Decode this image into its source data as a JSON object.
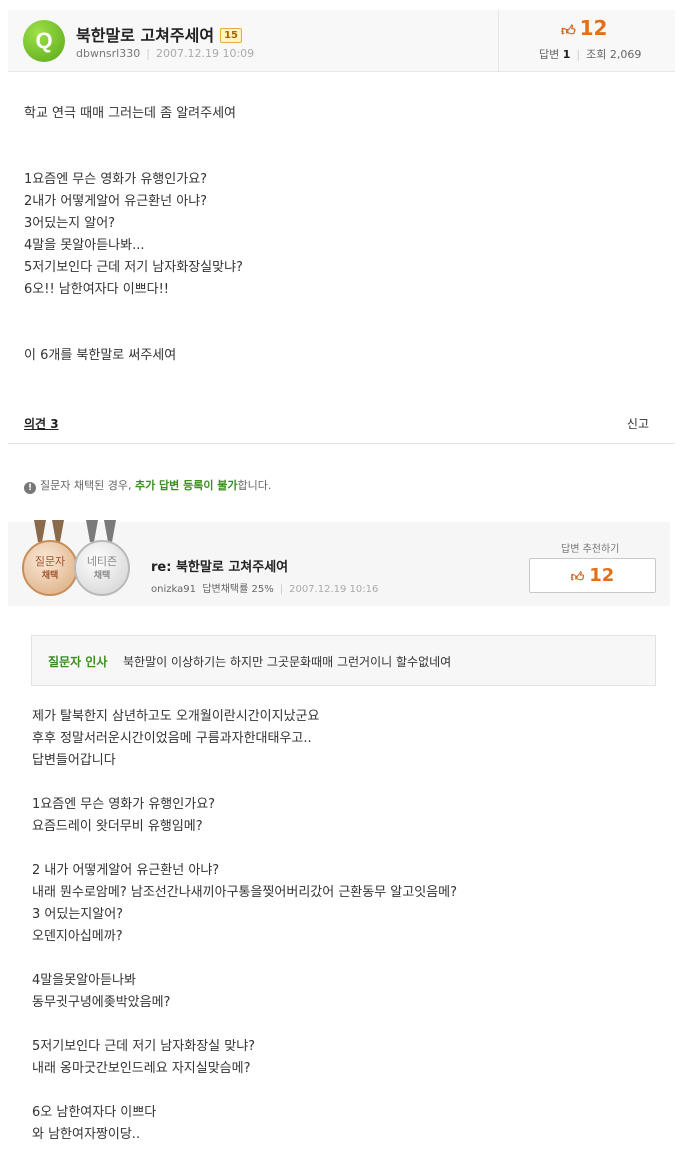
{
  "question": {
    "icon_letter": "Q",
    "title": "북한말로 고쳐주세여",
    "level": "15",
    "author": "dbwnsrl330",
    "date": "2007.12.19 10:09",
    "likes": "12",
    "answers_label": "답변",
    "answers_count": "1",
    "views_label": "조회",
    "views_count": "2,069",
    "intro": "학교 연극 때매 그러는데 좀 알려주세여",
    "lines": [
      "1요즘엔 무슨 영화가 유행인가요?",
      "2내가 어떻게알어 유근환넌 아냐?",
      "3어딨는지 알어?",
      "4말을 못알아듣나봐...",
      "5저기보인다 근데 저기 남자화장실맞냐?",
      "6오!! 남한여자다 이쁘다!!"
    ],
    "outro": "이 6개를 북한말로 써주세여"
  },
  "opinion_label": "의견 3",
  "report_label": "신고",
  "notice": {
    "before": "질문자 채택된 경우, ",
    "highlight": "추가 답변 등록이 불가",
    "after": "합니다."
  },
  "answer": {
    "medal_questioner": "질문자",
    "medal_questioner_sub": "채택",
    "medal_netizen": "네티즌",
    "medal_netizen_sub": "채택",
    "title": "re: 북한말로 고쳐주세여",
    "author": "onizka91",
    "adopt_rate": "답변채택률 25%",
    "date": "2007.12.19 10:16",
    "recommend_label": "답변 추천하기",
    "likes": "12",
    "greeting_label": "질문자 인사",
    "greeting_text": "북한말이 이상하기는 하지만 그곳문화때매 그런거이니 할수없네여",
    "body": [
      "제가 탈북한지 삼년하고도 오개월이란시간이지났군요",
      "후후 정말서러운시간이었음메 구름과자한대태우고..",
      "답변들어갑니다",
      "",
      "1요즘엔 무슨 영화가 유행인가요?",
      "요즘드레이 왓더무비 유행임메?",
      "",
      "2 내가 어떻게알어 유근환넌 아냐?",
      " 내래 뭔수로암메? 남조선간나새끼아구통을찢어버리갔어 근환동무 알고잇음메?",
      "3 어딨는지알어?",
      "오덴지아십메까?",
      "",
      "4말을못알아듣나봐",
      "동무귓구녕에좆박았음메?",
      "",
      "5저기보인다 근데 저기 남자화장실 맞냐?",
      "내래 옹마굿간보인드레요 자지실맞슴메?",
      "",
      "6오 남한여자다 이쁘다",
      "와 남한여자짱이당.."
    ]
  }
}
